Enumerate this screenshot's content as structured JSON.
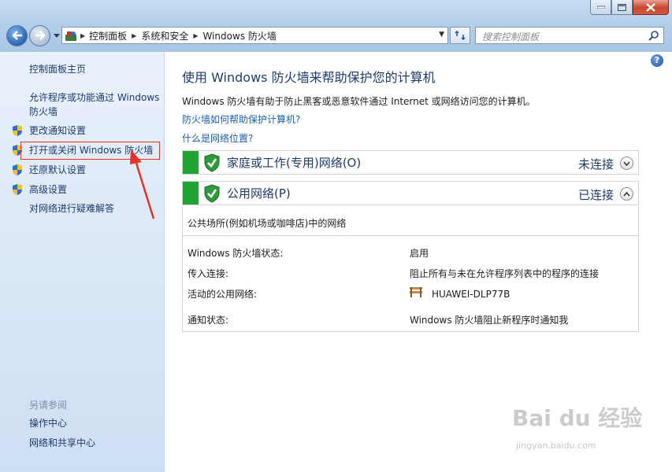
{
  "address": {
    "crumbs": [
      "控制面板",
      "系统和安全",
      "Windows 防火墙"
    ],
    "search_placeholder": "搜索控制面板"
  },
  "sidebar": {
    "home": "控制面板主页",
    "allow_programs": "允许程序或功能通过 Windows 防火墙",
    "items": [
      {
        "label": "更改通知设置",
        "icon": "shield-icon"
      },
      {
        "label": "打开或关闭 Windows 防火墙",
        "icon": "shield-icon"
      },
      {
        "label": "还原默认设置",
        "icon": "shield-icon"
      },
      {
        "label": "高级设置",
        "icon": "shield-icon"
      }
    ],
    "troubleshoot": "对网络进行疑难解答",
    "see_also": "另请参阅",
    "see_also_links": [
      "操作中心",
      "网络和共享中心"
    ]
  },
  "main": {
    "help": "?",
    "title": "使用 Windows 防火墙来帮助保护您的计算机",
    "description": "Windows 防火墙有助于防止黑客或恶意软件通过 Internet 或网络访问您的计算机。",
    "link_how": "防火墙如何帮助保护计算机?",
    "link_location": "什么是网络位置?",
    "networks": [
      {
        "name": "家庭或工作(专用)网络(O)",
        "status": "未连接",
        "expanded": false
      },
      {
        "name": "公用网络(P)",
        "status": "已连接",
        "expanded": true
      }
    ],
    "public_detail": {
      "description": "公共场所(例如机场或咖啡店)中的网络",
      "rows": [
        {
          "label": "Windows 防火墙状态:",
          "value": "启用"
        },
        {
          "label": "传入连接:",
          "value": "阻止所有与未在允许程序列表中的程序的连接"
        },
        {
          "label": "活动的公用网络:",
          "value": "HUAWEI-DLP77B"
        },
        {
          "label": "通知状态:",
          "value": "Windows 防火墙阻止新程序时通知我"
        }
      ]
    }
  },
  "watermark": {
    "main": "Bai du 经验",
    "sub": "jingyan.baidu.com"
  },
  "colors": {
    "accent_green": "#21a336",
    "link": "#1a5fb4",
    "highlight_red": "#e4332b"
  }
}
